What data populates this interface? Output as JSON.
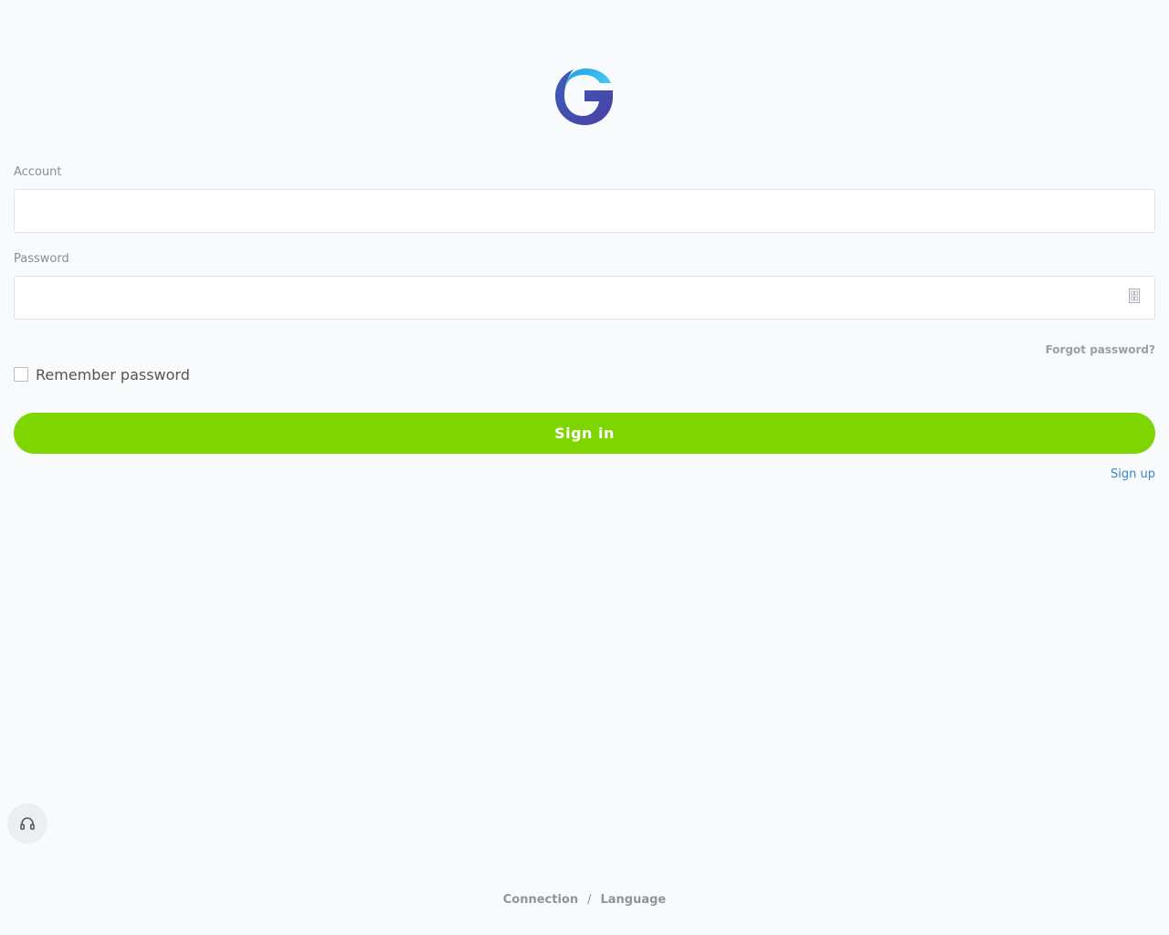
{
  "form": {
    "account_label": "Account",
    "account_value": "",
    "password_label": "Password",
    "password_value": "",
    "forgot_password": "Forgot password?",
    "remember_password": "Remember password",
    "sign_in": "Sign in",
    "sign_up": "Sign up"
  },
  "footer": {
    "connection": "Connection",
    "separator": "/",
    "language": "Language"
  },
  "icons": {
    "logo": "g-logo-icon",
    "password_toggle": "password-visibility-icon",
    "support": "headset-icon"
  },
  "colors": {
    "primary_button": "#7ed500",
    "link": "#3a86c8",
    "logo_blue": "#2fb0ea",
    "logo_indigo": "#3d4fb3"
  }
}
